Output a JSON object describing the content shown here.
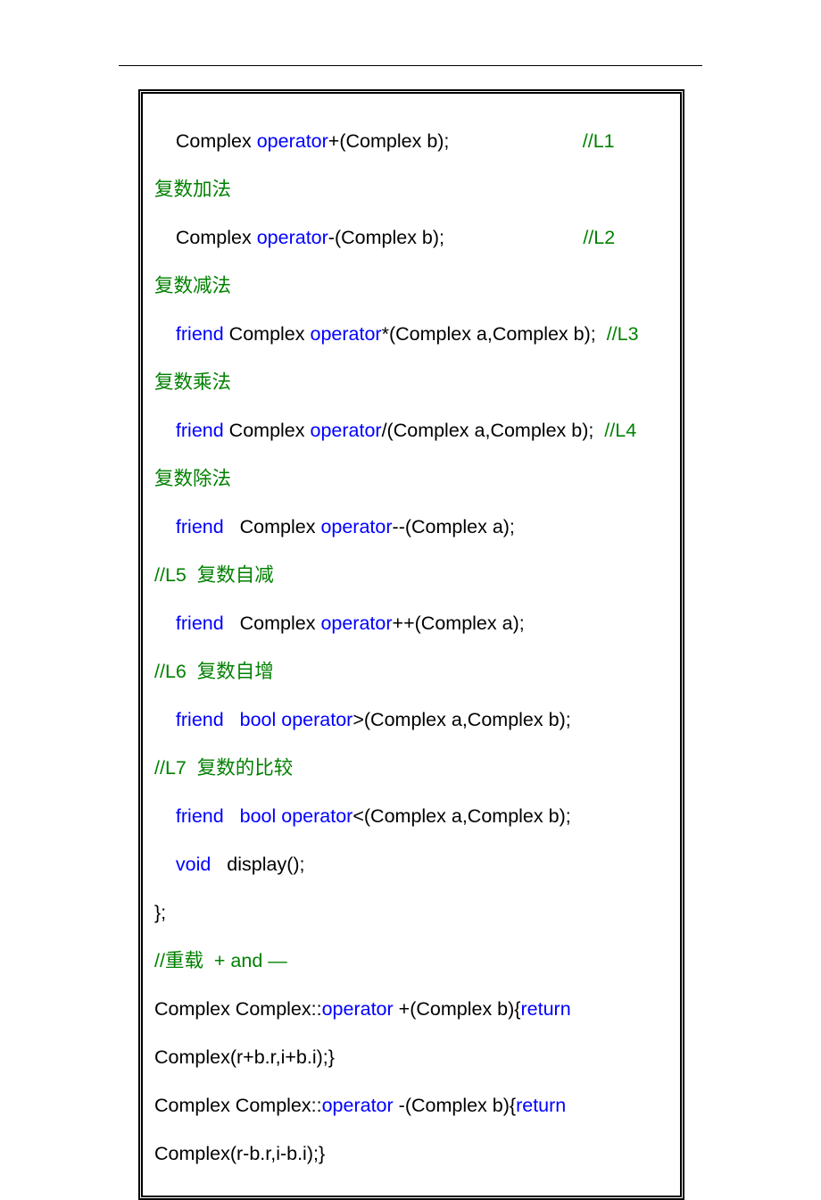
{
  "lines": [
    {
      "spans": [
        {
          "t": "    Complex "
        },
        {
          "t": "operator",
          "c": "kw-blue"
        },
        {
          "t": "+(Complex b);                         "
        },
        {
          "t": "//L1 ",
          "c": "kw-green"
        }
      ]
    },
    {
      "spans": [
        {
          "t": "复数加法",
          "c": "kw-green"
        }
      ]
    },
    {
      "spans": [
        {
          "t": "    Complex "
        },
        {
          "t": "operator",
          "c": "kw-blue"
        },
        {
          "t": "-(Complex b);                          "
        },
        {
          "t": "//L2 ",
          "c": "kw-green"
        }
      ]
    },
    {
      "spans": [
        {
          "t": "复数减法",
          "c": "kw-green"
        }
      ]
    },
    {
      "spans": [
        {
          "t": "    "
        },
        {
          "t": "friend ",
          "c": "kw-blue"
        },
        {
          "t": "Complex "
        },
        {
          "t": "operator",
          "c": "kw-blue"
        },
        {
          "t": "*(Complex a,Complex b);  "
        },
        {
          "t": "//L3 ",
          "c": "kw-green"
        }
      ]
    },
    {
      "spans": [
        {
          "t": "复数乘法",
          "c": "kw-green"
        }
      ]
    },
    {
      "spans": [
        {
          "t": "    "
        },
        {
          "t": "friend ",
          "c": "kw-blue"
        },
        {
          "t": "Complex "
        },
        {
          "t": "operator",
          "c": "kw-blue"
        },
        {
          "t": "/(Complex a,Complex b);  "
        },
        {
          "t": "//L4 ",
          "c": "kw-green"
        }
      ]
    },
    {
      "spans": [
        {
          "t": "复数除法",
          "c": "kw-green"
        }
      ]
    },
    {
      "spans": [
        {
          "t": "    "
        },
        {
          "t": "friend",
          "c": "kw-blue"
        },
        {
          "t": "   Complex "
        },
        {
          "t": "operator",
          "c": "kw-blue"
        },
        {
          "t": "--(Complex a);               "
        }
      ]
    },
    {
      "spans": [
        {
          "t": "//L5  复数自减",
          "c": "kw-green"
        }
      ]
    },
    {
      "spans": [
        {
          "t": "    "
        },
        {
          "t": "friend",
          "c": "kw-blue"
        },
        {
          "t": "   Complex "
        },
        {
          "t": "operator",
          "c": "kw-blue"
        },
        {
          "t": "++(Complex a);              "
        }
      ]
    },
    {
      "spans": [
        {
          "t": "//L6  复数自增",
          "c": "kw-green"
        }
      ]
    },
    {
      "spans": [
        {
          "t": "    "
        },
        {
          "t": "friend",
          "c": "kw-blue"
        },
        {
          "t": "   "
        },
        {
          "t": "bool ",
          "c": "kw-blue"
        },
        {
          "t": "operator",
          "c": "kw-blue"
        },
        {
          "t": ">(Complex a,Complex b);     "
        }
      ]
    },
    {
      "spans": [
        {
          "t": "//L7  复数的比较",
          "c": "kw-green"
        }
      ]
    },
    {
      "spans": [
        {
          "t": "    "
        },
        {
          "t": "friend",
          "c": "kw-blue"
        },
        {
          "t": "   "
        },
        {
          "t": "bool ",
          "c": "kw-blue"
        },
        {
          "t": "operator",
          "c": "kw-blue"
        },
        {
          "t": "<(Complex a,Complex b);"
        }
      ]
    },
    {
      "spans": [
        {
          "t": "    "
        },
        {
          "t": "void",
          "c": "kw-blue"
        },
        {
          "t": "   display();"
        }
      ]
    },
    {
      "spans": [
        {
          "t": "};"
        }
      ]
    },
    {
      "spans": [
        {
          "t": "//重载  + and —",
          "c": "kw-green"
        }
      ]
    },
    {
      "spans": [
        {
          "t": "Complex Complex::"
        },
        {
          "t": "operator ",
          "c": "kw-blue"
        },
        {
          "t": "+(Complex b){"
        },
        {
          "t": "return ",
          "c": "kw-blue"
        }
      ]
    },
    {
      "spans": [
        {
          "t": "Complex(r+b.r,i+b.i);}"
        }
      ]
    },
    {
      "spans": [
        {
          "t": "Complex Complex::"
        },
        {
          "t": "operator ",
          "c": "kw-blue"
        },
        {
          "t": "-(Complex b){"
        },
        {
          "t": "return ",
          "c": "kw-blue"
        }
      ]
    },
    {
      "spans": [
        {
          "t": "Complex(r-b.r,i-b.i);}"
        }
      ]
    }
  ]
}
